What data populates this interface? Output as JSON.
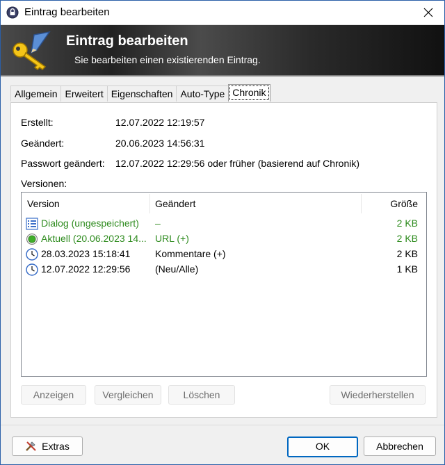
{
  "window": {
    "title": "Eintrag bearbeiten"
  },
  "banner": {
    "title": "Eintrag bearbeiten",
    "subtitle": "Sie bearbeiten einen existierenden Eintrag."
  },
  "tabs": [
    {
      "label": "Allgemein",
      "active": false
    },
    {
      "label": "Erweitert",
      "active": false
    },
    {
      "label": "Eigenschaften",
      "active": false
    },
    {
      "label": "Auto-Type",
      "active": false
    },
    {
      "label": "Chronik",
      "active": true
    }
  ],
  "info": {
    "created_label": "Erstellt:",
    "created_value": "12.07.2022 12:19:57",
    "modified_label": "Geändert:",
    "modified_value": "20.06.2023 14:56:31",
    "password_label": "Passwort geändert:",
    "password_value": "12.07.2022 12:29:56 oder früher (basierend auf Chronik)"
  },
  "versions": {
    "label": "Versionen:",
    "columns": [
      "Version",
      "Geändert",
      "Größe"
    ],
    "rows": [
      {
        "version": "Dialog (ungespeichert)",
        "changed": "–",
        "size": "2 KB",
        "icon": "list-icon",
        "color": "#2e8b1e"
      },
      {
        "version": "Aktuell (20.06.2023 14...",
        "changed": "URL (+)",
        "size": "2 KB",
        "icon": "green-circle-icon",
        "color": "#2e8b1e"
      },
      {
        "version": "28.03.2023 15:18:41",
        "changed": "Kommentare (+)",
        "size": "2 KB",
        "icon": "clock-icon",
        "color": "#000000"
      },
      {
        "version": "12.07.2022 12:29:56",
        "changed": "(Neu/Alle)",
        "size": "1 KB",
        "icon": "clock-icon",
        "color": "#000000"
      }
    ]
  },
  "actions": {
    "show": "Anzeigen",
    "compare": "Vergleichen",
    "delete": "Löschen",
    "restore": "Wiederherstellen"
  },
  "footer": {
    "extras": "Extras",
    "ok": "OK",
    "cancel": "Abbrechen"
  },
  "colors": {
    "accent": "#0067c0",
    "green_text": "#2e8b1e"
  }
}
